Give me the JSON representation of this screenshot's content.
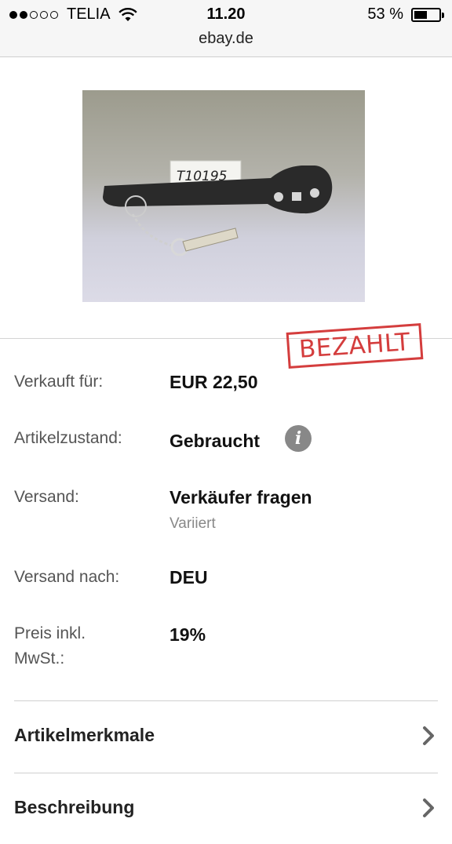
{
  "status_bar": {
    "carrier": "TELIA",
    "signal_bars_filled": 2,
    "signal_bars_total": 5,
    "time": "11.20",
    "battery_percent_label": "53 %",
    "battery_level": 0.53,
    "url": "ebay.de"
  },
  "product": {
    "image_tag_text": "T10195",
    "stamp": "BEZAHLT"
  },
  "details": [
    {
      "label": "Verkauft für:",
      "value": "EUR 22,50"
    },
    {
      "label": "Artikelzustand:",
      "value": "Gebraucht"
    },
    {
      "label": "Versand:",
      "value": "Verkäufer fragen",
      "sub": "Variiert"
    },
    {
      "label": "Versand nach:",
      "value": "DEU"
    },
    {
      "label": "Preis inkl.",
      "label2": "MwSt.:",
      "value": "19%"
    }
  ],
  "sections": [
    {
      "label": "Artikelmerkmale",
      "icon": "chevron-right-icon"
    },
    {
      "label": "Beschreibung",
      "icon": "chevron-right-icon"
    }
  ],
  "colors": {
    "stamp_red": "#d43d3d",
    "info_icon_gray": "#888888"
  }
}
